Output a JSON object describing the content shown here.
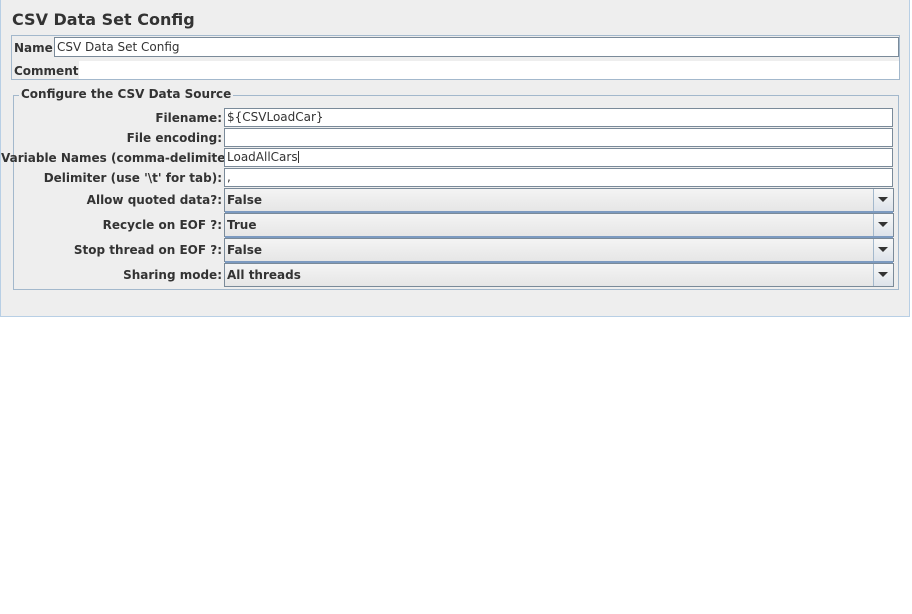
{
  "window": {
    "title": "CSV Data Set Config"
  },
  "name_section": {
    "name_label": "Name:",
    "name_value": "CSV Data Set Config",
    "comments_label": "Comments:",
    "comments_value": ""
  },
  "csv_source": {
    "group_title": "Configure the CSV Data Source",
    "filename_label": "Filename:",
    "filename_value": "${CSVLoadCar}",
    "encoding_label": "File encoding:",
    "encoding_value": "",
    "varnames_label": "Variable Names (comma-delimited):",
    "varnames_value": "LoadAllCars",
    "delimiter_label": "Delimiter (use '\\t' for tab):",
    "delimiter_value": ",",
    "allow_quoted_label": "Allow quoted data?:",
    "allow_quoted_value": "False",
    "recycle_label": "Recycle on EOF ?:",
    "recycle_value": "True",
    "stop_thread_label": "Stop thread on EOF ?:",
    "stop_thread_value": "False",
    "sharing_label": "Sharing mode:",
    "sharing_value": "All threads"
  },
  "icons": {
    "dropdown": "chevron-down-icon"
  },
  "colors": {
    "panel_bg": "#eeeeee",
    "border": "#a3b8cc",
    "text": "#333333"
  }
}
